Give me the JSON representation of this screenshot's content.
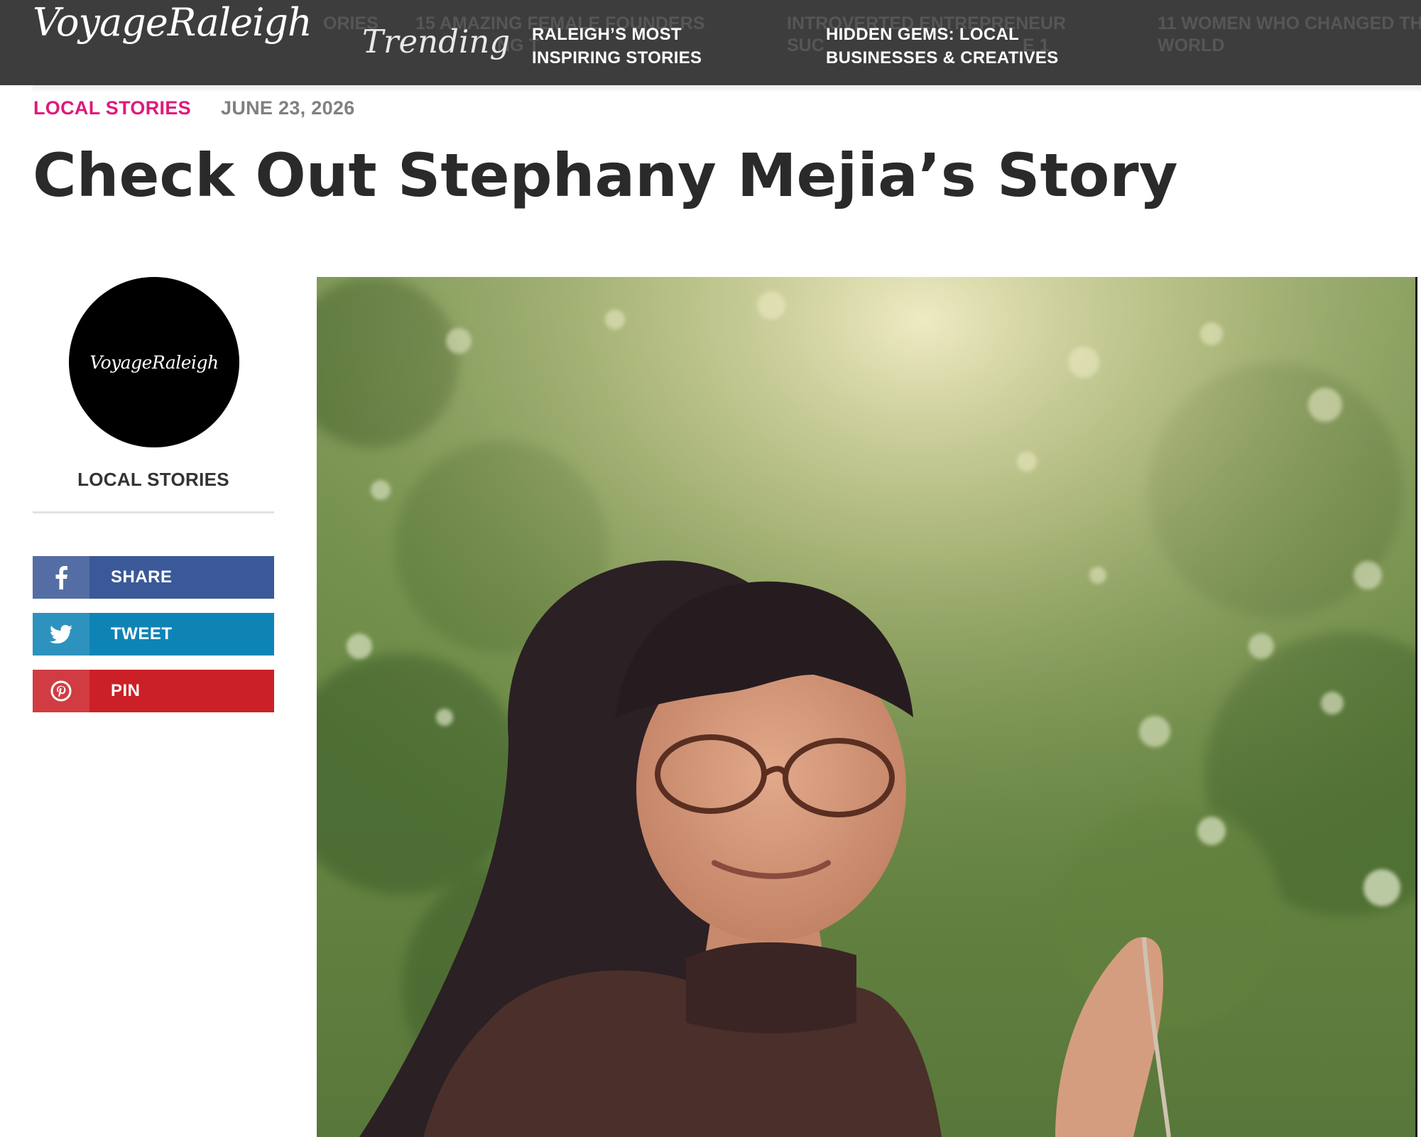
{
  "header": {
    "logo": "VoyageRaleigh",
    "trending_label": "Trending",
    "background_ghost_items": [
      "ORIES",
      "15 AMAZING FEMALE FOUNDERS",
      "NG T",
      "INTROVERTED ENTREPRENEUR",
      "SUC",
      "E 1",
      "11 WOMEN WHO CHANGED TH",
      "WORLD"
    ],
    "trending_items": [
      {
        "line1": "RALEIGH’S MOST",
        "line2": "INSPIRING STORIES"
      },
      {
        "line1": "HIDDEN GEMS: LOCAL",
        "line2": "BUSINESSES & CREATIVES"
      }
    ]
  },
  "article": {
    "category": "LOCAL STORIES",
    "date": "JUNE 23, 2026",
    "title": "Check Out Stephany Mejia’s Story",
    "hero_image_icon": "portrait-photo"
  },
  "sidebar": {
    "author_avatar_text": "VoyageRaleigh",
    "author_label": "LOCAL STORIES",
    "share_buttons": [
      {
        "label": "SHARE",
        "icon": "facebook-icon",
        "color": "#3b5998"
      },
      {
        "label": "TWEET",
        "icon": "twitter-icon",
        "color": "#0e84b5"
      },
      {
        "label": "PIN",
        "icon": "pinterest-icon",
        "color": "#cb2027"
      }
    ]
  },
  "colors": {
    "topbar": "#3d3d3d",
    "category_accent": "#e0187a",
    "date_text": "#808080",
    "title_text": "#2a2a2a"
  }
}
